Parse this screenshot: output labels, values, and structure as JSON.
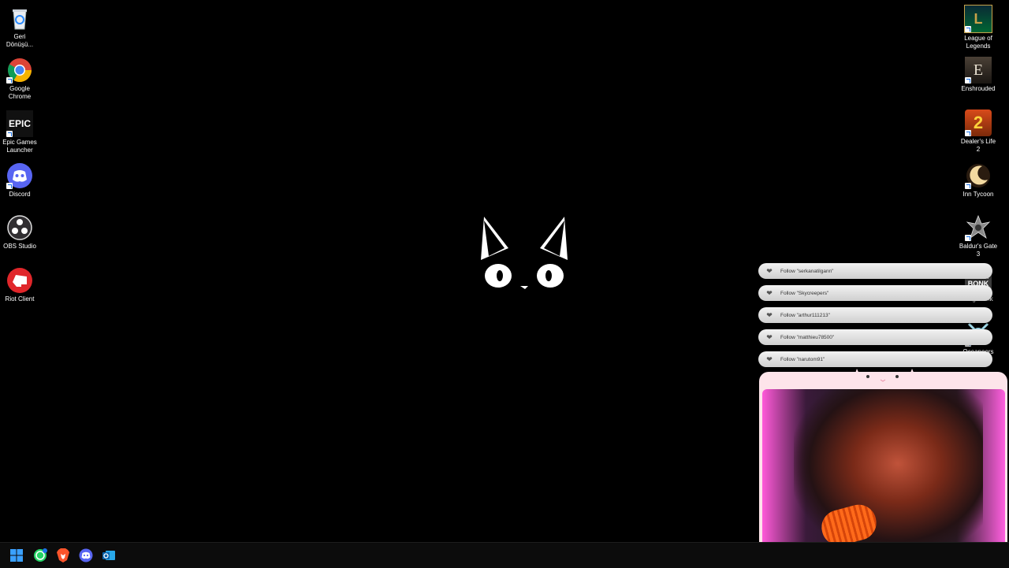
{
  "desktop": {
    "left_icons": [
      {
        "label": "Geri Dönüşü...",
        "icon": "recycle-bin-icon"
      },
      {
        "label": "Google Chrome",
        "icon": "chrome-icon"
      },
      {
        "label": "Epic Games Launcher",
        "icon": "epic-games-icon",
        "glyph": "EPIC"
      },
      {
        "label": "Discord",
        "icon": "discord-icon"
      },
      {
        "label": "OBS Studio",
        "icon": "obs-icon"
      },
      {
        "label": "Riot Client",
        "icon": "riot-icon"
      }
    ],
    "right_icons": [
      {
        "label": "League of Legends",
        "icon": "league-of-legends-icon",
        "glyph": "L"
      },
      {
        "label": "Enshrouded",
        "icon": "enshrouded-icon",
        "glyph": "E"
      },
      {
        "label": "Dealer's Life 2",
        "icon": "dealers-life-icon",
        "glyph": "2"
      },
      {
        "label": "Inn Tycoon",
        "icon": "inn-tycoon-icon"
      },
      {
        "label": "Baldur's Gate 3",
        "icon": "baldurs-gate-icon"
      },
      {
        "label": "Megabonk",
        "icon": "megabonk-icon",
        "glyph": "MEGA BONK"
      },
      {
        "label": "Oceaneers Demo",
        "icon": "oceaneers-icon"
      }
    ]
  },
  "follow_alerts": [
    "Follow \"serkanatilgann\"",
    "Follow \"Skycreepers\"",
    "Follow \"arthur111213\"",
    "Follow \"matthieu78500\"",
    "Follow \"narutom91\""
  ],
  "colors": {
    "desktop_bg": "#000000",
    "cam_frame": "#fde4ea",
    "alert_bg": "#e6e6e6"
  }
}
